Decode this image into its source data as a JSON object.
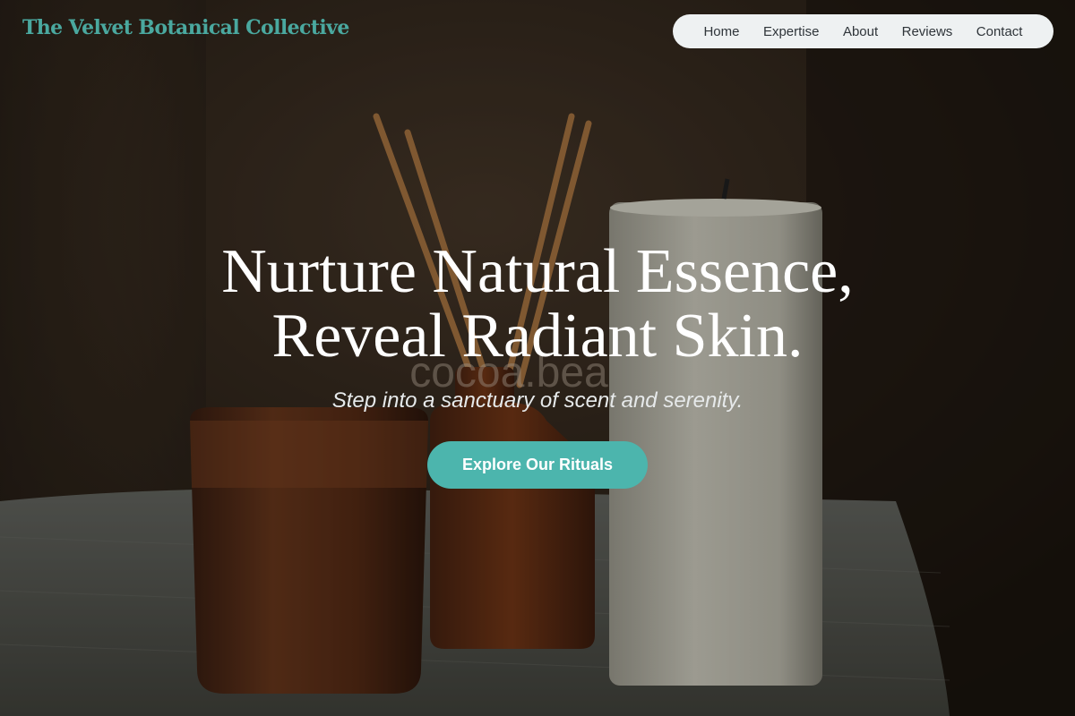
{
  "brand": {
    "name": "The Velvet Botanical Collective"
  },
  "nav": {
    "items": [
      {
        "label": "Home"
      },
      {
        "label": "Expertise"
      },
      {
        "label": "About"
      },
      {
        "label": "Reviews"
      },
      {
        "label": "Contact"
      }
    ]
  },
  "hero": {
    "headline_line1": "Nurture Natural Essence,",
    "headline_line2": "Reveal Radiant Skin.",
    "subtitle": "Step into a sanctuary of scent and serenity.",
    "cta_label": "Explore Our Rituals",
    "jar_label": "cocoa.beauty"
  },
  "colors": {
    "accent": "#4cb5ad",
    "logo": "#4aa89f",
    "nav_bg": "#eef1f2",
    "nav_text": "#2f353a"
  }
}
